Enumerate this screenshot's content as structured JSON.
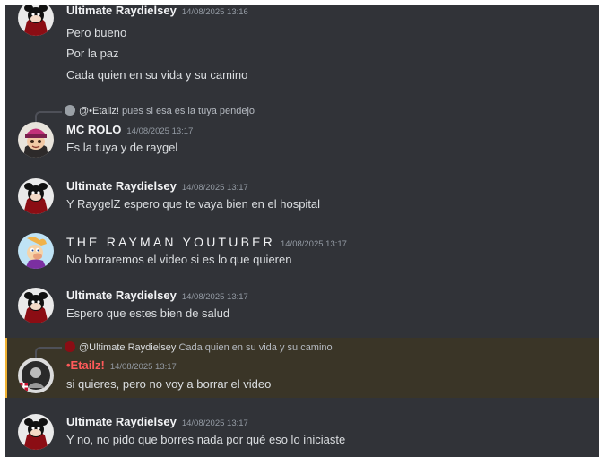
{
  "messages": [
    {
      "author": "Ultimate Raydielsey",
      "timestamp": "14/08/2025 13:16",
      "lines": [
        "Pero bueno",
        "Por la paz",
        "Cada quien en su vida y su camino"
      ]
    },
    {
      "reply": {
        "author": "@•Etailz!",
        "text": "pues si esa es la tuya pendejo"
      },
      "author": "MC ROLO",
      "timestamp": "14/08/2025 13:17",
      "lines": [
        "Es la tuya y de raygel"
      ]
    },
    {
      "author": "Ultimate Raydielsey",
      "timestamp": "14/08/2025 13:17",
      "lines": [
        "Y RaygelZ espero que te vaya bien en el hospital"
      ]
    },
    {
      "author": "THE RAYMAN YOUTUBER",
      "timestamp": "14/08/2025 13:17",
      "lines": [
        "No borraremos el video si es lo que quieren"
      ]
    },
    {
      "author": "Ultimate Raydielsey",
      "timestamp": "14/08/2025 13:17",
      "lines": [
        "Espero que estes bien de salud"
      ]
    },
    {
      "reply": {
        "author": "@Ultimate Raydielsey",
        "text": "Cada quien en su vida y su camino"
      },
      "author": "•Etailz!",
      "timestamp": "14/08/2025 13:17",
      "lines": [
        "si quieres, pero no voy a borrar el video"
      ],
      "highlighted": true
    },
    {
      "author": "Ultimate Raydielsey",
      "timestamp": "14/08/2025 13:17",
      "lines": [
        "Y no, no pido que borres nada por qué eso lo iniciaste"
      ]
    }
  ],
  "colors": {
    "background": "#313338",
    "mention_highlight": "#3a3527",
    "mention_bar": "#f0b232",
    "etailz_name": "#ff5a5a"
  }
}
